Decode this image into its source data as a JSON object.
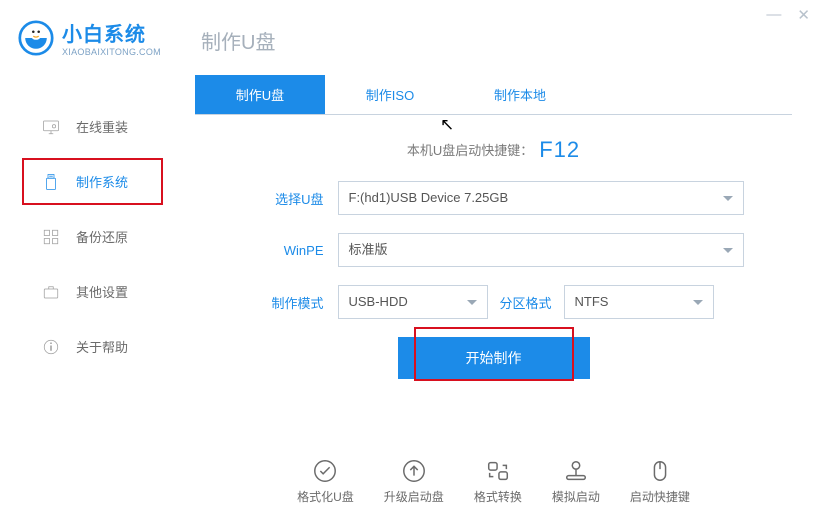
{
  "window": {
    "min": "—",
    "close": "✕"
  },
  "logo": {
    "cn": "小白系统",
    "en": "XIAOBAIXITONG.COM"
  },
  "nav": [
    {
      "label": "在线重装"
    },
    {
      "label": "制作系统"
    },
    {
      "label": "备份还原"
    },
    {
      "label": "其他设置"
    },
    {
      "label": "关于帮助"
    }
  ],
  "page": {
    "title": "制作U盘"
  },
  "tabs": [
    {
      "label": "制作U盘"
    },
    {
      "label": "制作ISO"
    },
    {
      "label": "制作本地"
    }
  ],
  "hint": {
    "text": "本机U盘启动快捷键：",
    "key": "F12"
  },
  "form": {
    "usb_label": "选择U盘",
    "usb_value": "F:(hd1)USB Device 7.25GB",
    "winpe_label": "WinPE",
    "winpe_value": "标准版",
    "mode_label": "制作模式",
    "mode_value": "USB-HDD",
    "part_label": "分区格式",
    "part_value": "NTFS"
  },
  "main_btn": "开始制作",
  "bottom": [
    {
      "label": "格式化U盘"
    },
    {
      "label": "升级启动盘"
    },
    {
      "label": "格式转换"
    },
    {
      "label": "模拟启动"
    },
    {
      "label": "启动快捷键"
    }
  ]
}
